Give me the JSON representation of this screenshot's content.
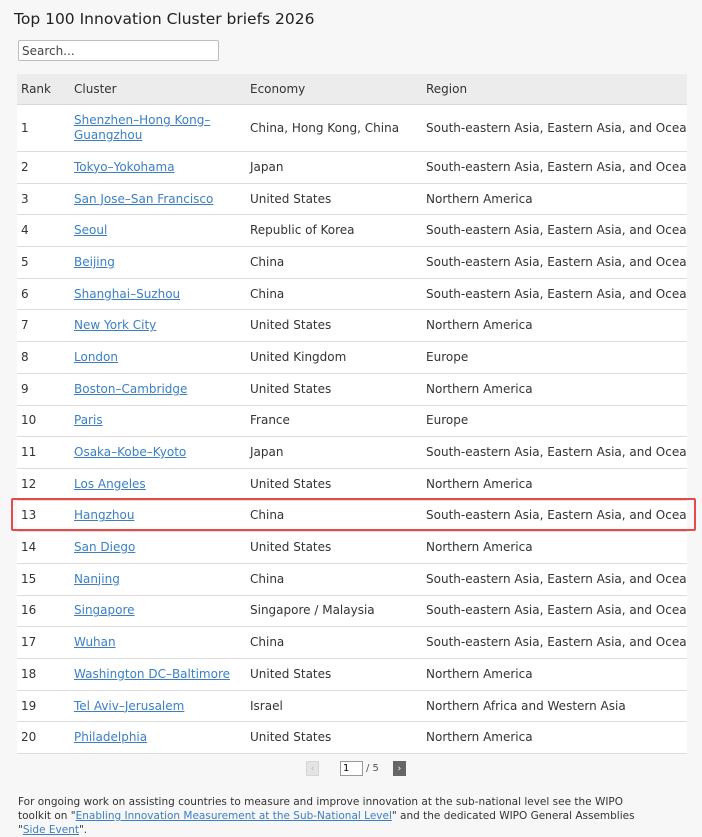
{
  "page": {
    "title": "Top 100 Innovation Cluster briefs 2026"
  },
  "search": {
    "placeholder": "Search..."
  },
  "table": {
    "headers": [
      "Rank",
      "Cluster",
      "Economy",
      "Region"
    ],
    "rows": [
      {
        "rank": "1",
        "cluster": "Shenzhen–Hong Kong–Guangzhou",
        "economy": "China, Hong Kong, China",
        "region": "South-eastern Asia, Eastern Asia, and Oceania"
      },
      {
        "rank": "2",
        "cluster": "Tokyo–Yokohama",
        "economy": "Japan",
        "region": "South-eastern Asia, Eastern Asia, and Oceania"
      },
      {
        "rank": "3",
        "cluster": "San Jose–San Francisco",
        "economy": "United States",
        "region": "Northern America"
      },
      {
        "rank": "4",
        "cluster": "Seoul",
        "economy": "Republic of Korea",
        "region": "South-eastern Asia, Eastern Asia, and Oceania"
      },
      {
        "rank": "5",
        "cluster": "Beijing",
        "economy": "China",
        "region": "South-eastern Asia, Eastern Asia, and Oceania"
      },
      {
        "rank": "6",
        "cluster": "Shanghai–Suzhou",
        "economy": "China",
        "region": "South-eastern Asia, Eastern Asia, and Oceania"
      },
      {
        "rank": "7",
        "cluster": "New York City",
        "economy": "United States",
        "region": "Northern America"
      },
      {
        "rank": "8",
        "cluster": "London",
        "economy": "United Kingdom",
        "region": "Europe"
      },
      {
        "rank": "9",
        "cluster": "Boston–Cambridge",
        "economy": "United States",
        "region": "Northern America"
      },
      {
        "rank": "10",
        "cluster": "Paris",
        "economy": "France",
        "region": "Europe"
      },
      {
        "rank": "11",
        "cluster": "Osaka–Kobe–Kyoto",
        "economy": "Japan",
        "region": "South-eastern Asia, Eastern Asia, and Oceania"
      },
      {
        "rank": "12",
        "cluster": "Los Angeles",
        "economy": "United States",
        "region": "Northern America"
      },
      {
        "rank": "13",
        "cluster": "Hangzhou",
        "economy": "China",
        "region": "South-eastern Asia, Eastern Asia, and Oceania"
      },
      {
        "rank": "14",
        "cluster": "San Diego",
        "economy": "United States",
        "region": "Northern America"
      },
      {
        "rank": "15",
        "cluster": "Nanjing",
        "economy": "China",
        "region": "South-eastern Asia, Eastern Asia, and Oceania"
      },
      {
        "rank": "16",
        "cluster": "Singapore",
        "economy": "Singapore / Malaysia",
        "region": "South-eastern Asia, Eastern Asia, and Oceania"
      },
      {
        "rank": "17",
        "cluster": "Wuhan",
        "economy": "China",
        "region": "South-eastern Asia, Eastern Asia, and Oceania"
      },
      {
        "rank": "18",
        "cluster": "Washington DC–Baltimore",
        "economy": "United States",
        "region": "Northern America"
      },
      {
        "rank": "19",
        "cluster": "Tel Aviv–Jerusalem",
        "economy": "Israel",
        "region": "Northern Africa and Western Asia"
      },
      {
        "rank": "20",
        "cluster": "Philadelphia",
        "economy": "United States",
        "region": "Northern America"
      }
    ],
    "highlighted_rank": "13"
  },
  "pagination": {
    "prev_icon": "‹",
    "next_icon": "›",
    "current_page": "1",
    "total_label": "/ 5"
  },
  "footer": {
    "text_1": "For ongoing work on assisting countries to measure and improve innovation at the sub-national level see the WIPO toolkit on \"",
    "link_1": "Enabling Innovation Measurement at the Sub-National Level",
    "text_2": "\" and the dedicated WIPO General Assemblies \"",
    "link_2": "Side Event",
    "text_3": "\"."
  },
  "colors": {
    "link": "#3b7fc4",
    "highlight_border": "#e34b4b",
    "header_bg": "#ececec"
  }
}
